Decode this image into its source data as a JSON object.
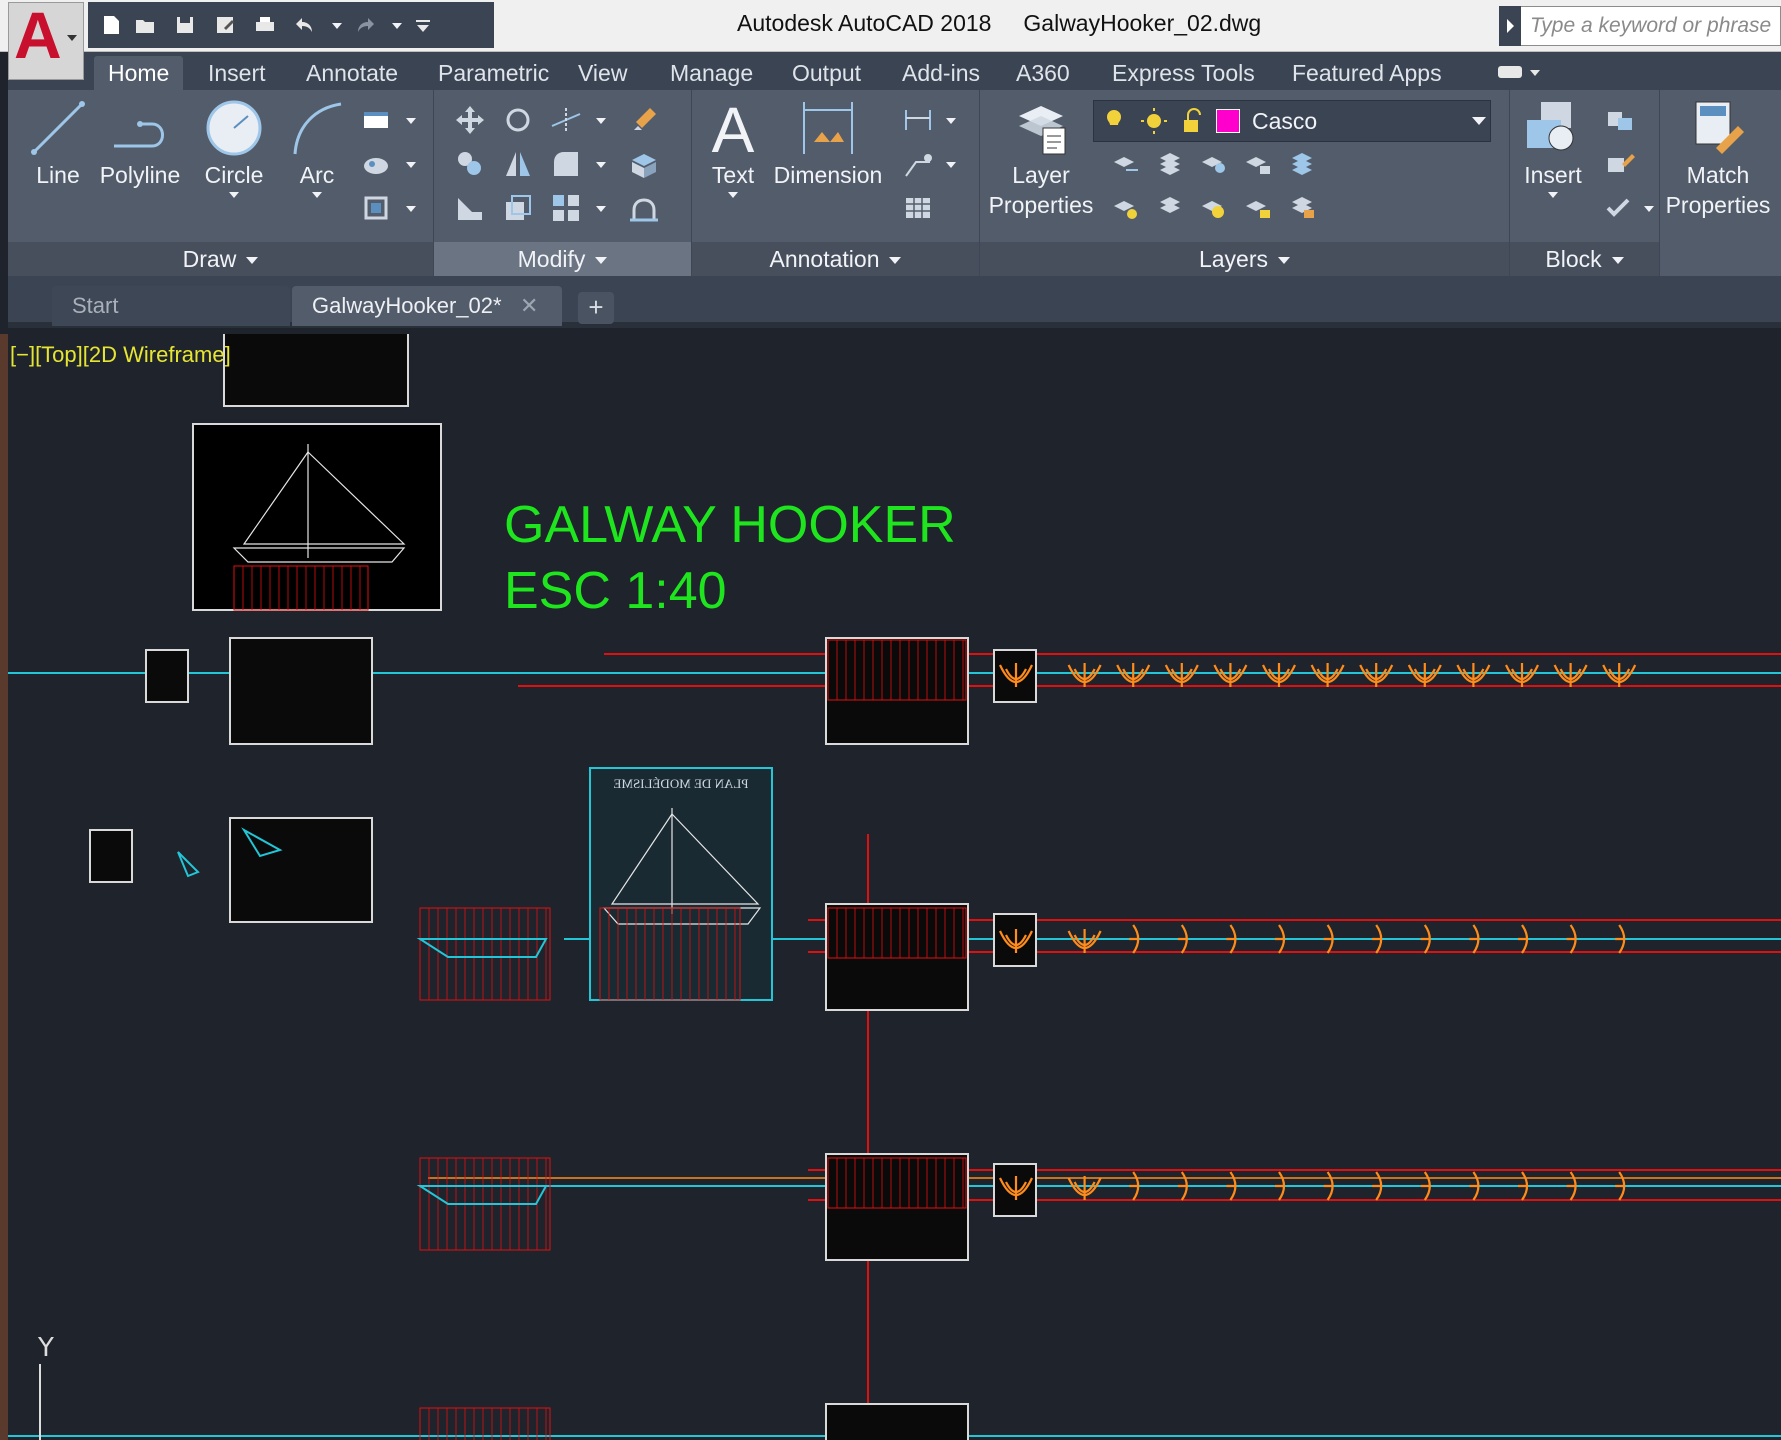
{
  "app": {
    "logo_letter": "A",
    "title": "Autodesk AutoCAD 2018     GalwayHooker_02.dwg"
  },
  "search": {
    "placeholder": "Type a keyword or phrase"
  },
  "ribbon_tabs": [
    {
      "label": "Home"
    },
    {
      "label": "Insert"
    },
    {
      "label": "Annotate"
    },
    {
      "label": "Parametric"
    },
    {
      "label": "View"
    },
    {
      "label": "Manage"
    },
    {
      "label": "Output"
    },
    {
      "label": "Add-ins"
    },
    {
      "label": "A360"
    },
    {
      "label": "Express Tools"
    },
    {
      "label": "Featured Apps"
    }
  ],
  "draw": {
    "title": "Draw",
    "line": "Line",
    "polyline": "Polyline",
    "circle": "Circle",
    "arc": "Arc"
  },
  "modify": {
    "title": "Modify"
  },
  "annotation": {
    "title": "Annotation",
    "text": "Text",
    "dimension": "Dimension"
  },
  "layers": {
    "title": "Layers",
    "props_line1": "Layer",
    "props_line2": "Properties",
    "current_layer": "Casco",
    "current_color": "#ff00cc"
  },
  "block": {
    "title": "Block",
    "insert": "Insert"
  },
  "match": {
    "line1": "Match",
    "line2": "Properties"
  },
  "doc_tabs": {
    "start": "Start",
    "file": "GalwayHooker_02*"
  },
  "viewport": {
    "label": "[−][Top][2D Wireframe]"
  },
  "drawing": {
    "title_line1": "GALWAY HOOKER",
    "title_line2": "ESC 1:40",
    "plan_heading": "PLAN DE MODÉLISME",
    "ucs_axis": "Y"
  },
  "colors": {
    "accent_green": "#1ee51e",
    "red_lines": "#e01010",
    "cyan_lines": "#22c6d6",
    "orange_sections": "#ff8c1a",
    "canvas_bg": "#1f232b"
  }
}
